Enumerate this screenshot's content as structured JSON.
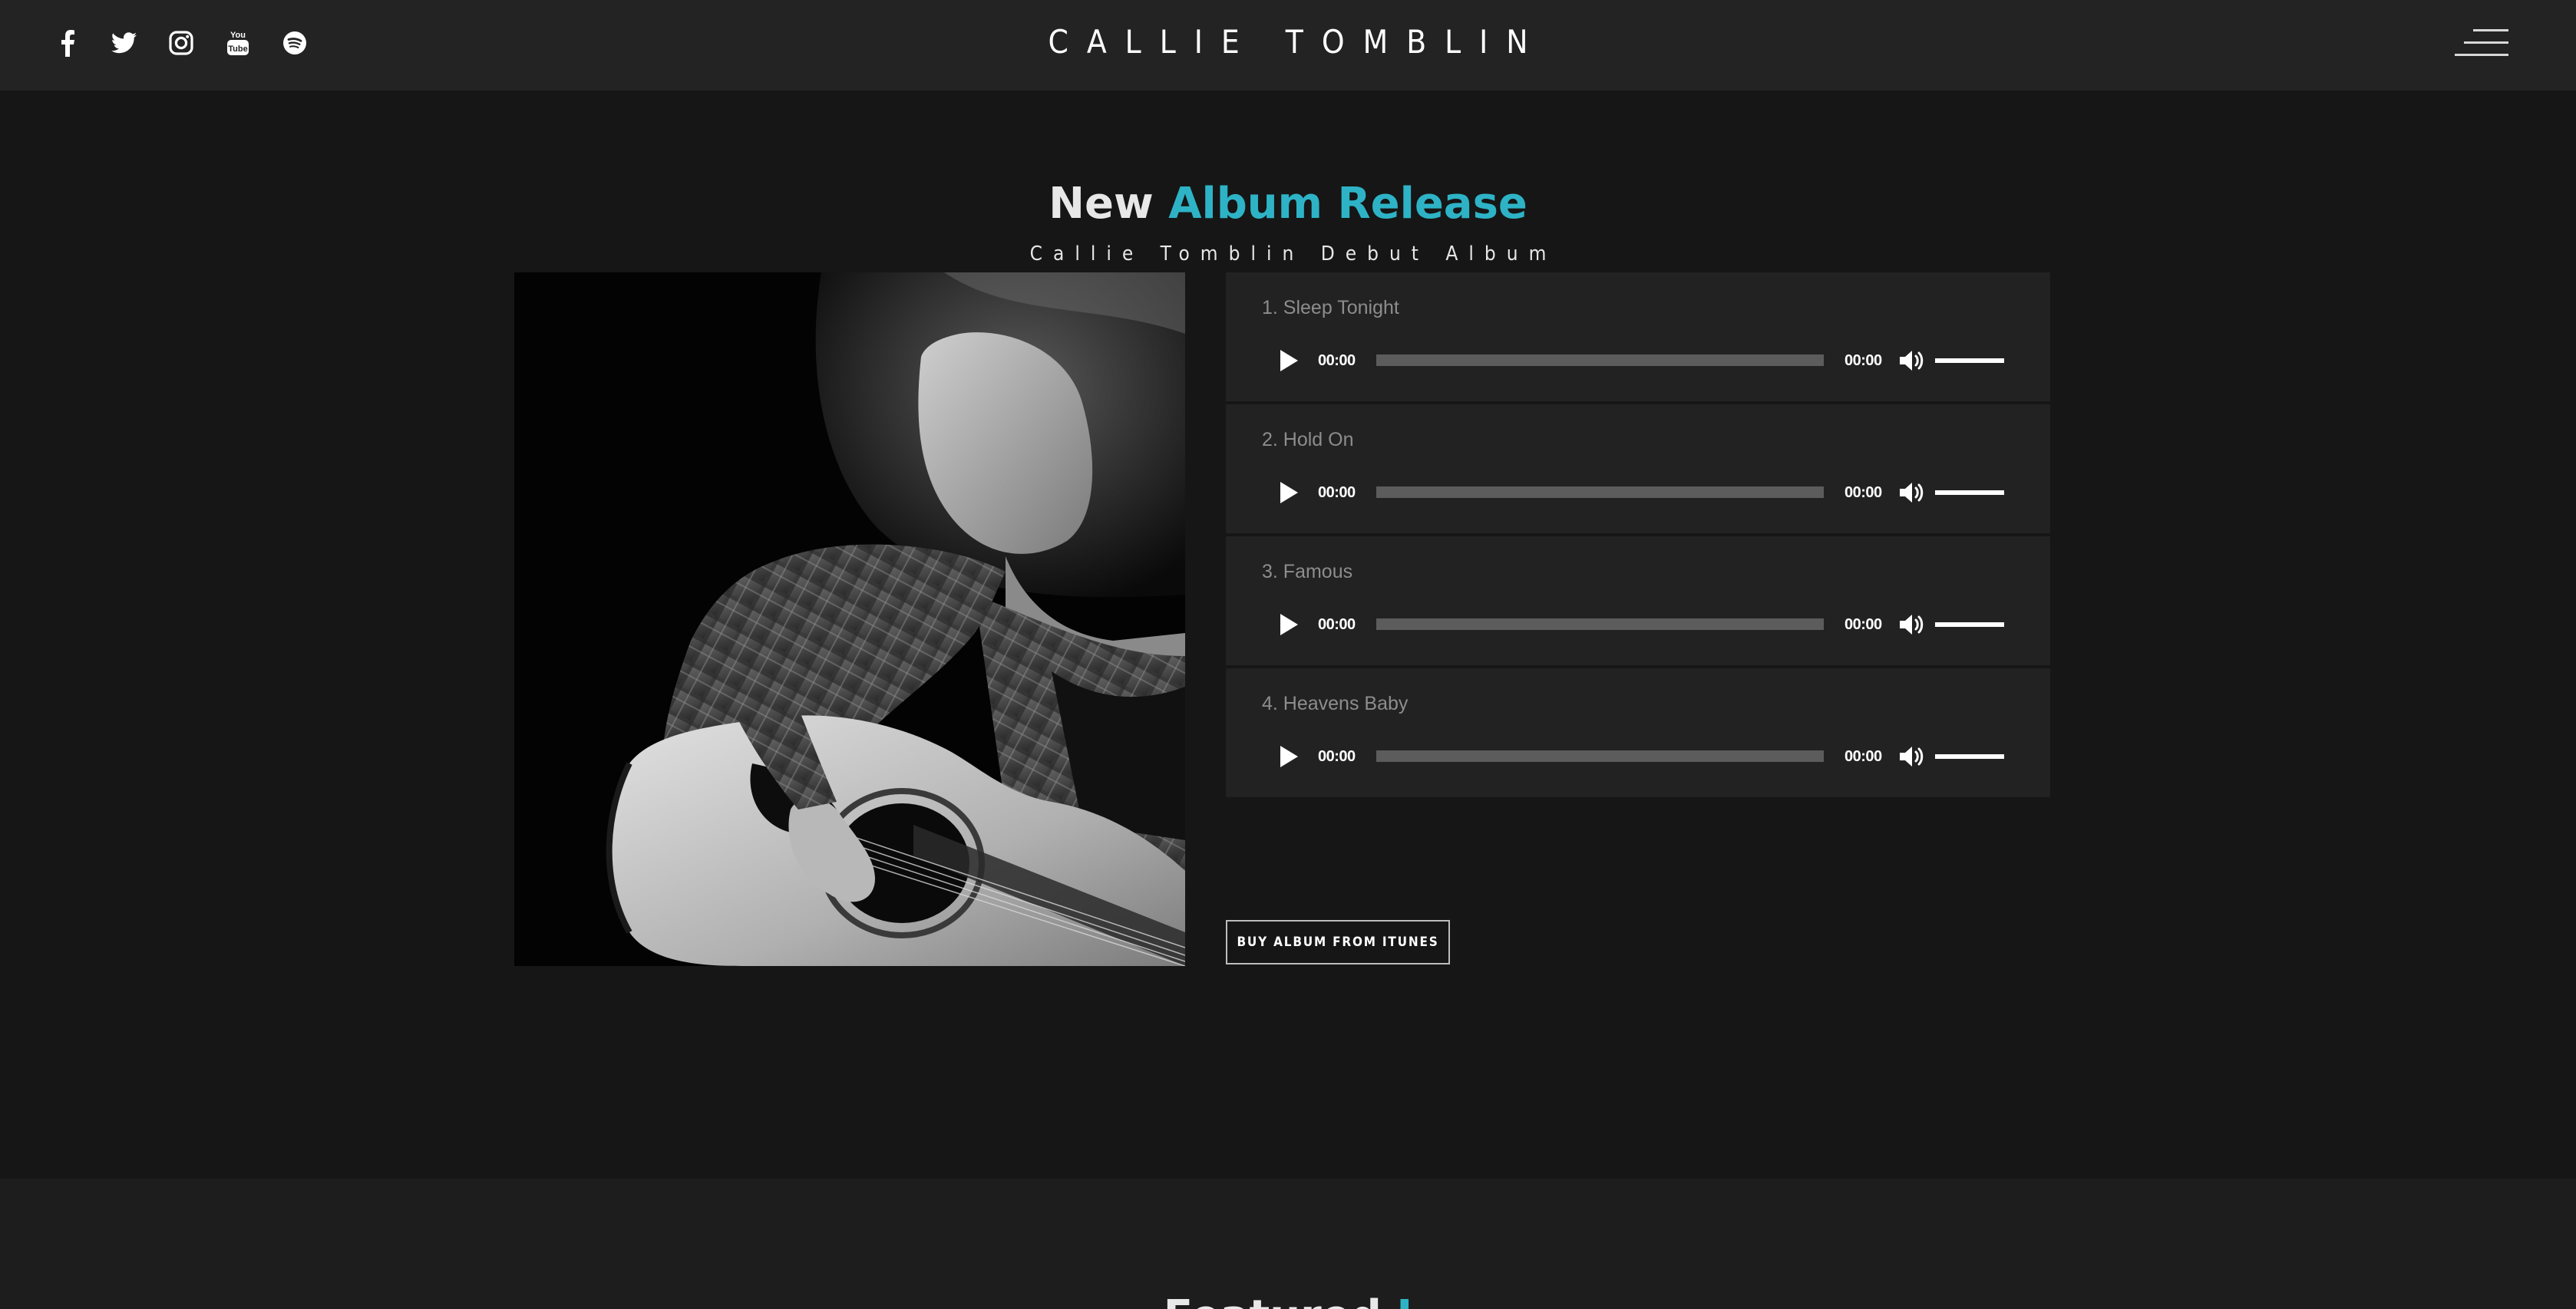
{
  "header": {
    "brand": "CALLIE TOMBLIN",
    "social_icons": [
      "facebook-icon",
      "twitter-icon",
      "instagram-icon",
      "youtube-icon",
      "spotify-icon"
    ],
    "menu_icon": "hamburger-menu-icon"
  },
  "album": {
    "headline_plain": "New",
    "headline_accent": "Album Release",
    "subheadline": "Callie Tomblin Debut Album",
    "accent_color": "#2eb3c6",
    "cover_alt": "Black and white photo of woman playing acoustic guitar",
    "tracks": [
      {
        "title": "1. Sleep Tonight",
        "current": "00:00",
        "duration": "00:00"
      },
      {
        "title": "2. Hold On",
        "current": "00:00",
        "duration": "00:00"
      },
      {
        "title": "3. Famous",
        "current": "00:00",
        "duration": "00:00"
      },
      {
        "title": "4. Heavens Baby",
        "current": "00:00",
        "duration": "00:00"
      }
    ],
    "buy_label": "BUY ALBUM FROM ITUNES"
  },
  "next_section": {
    "heading_plain": "Featured",
    "heading_accent": "I"
  }
}
